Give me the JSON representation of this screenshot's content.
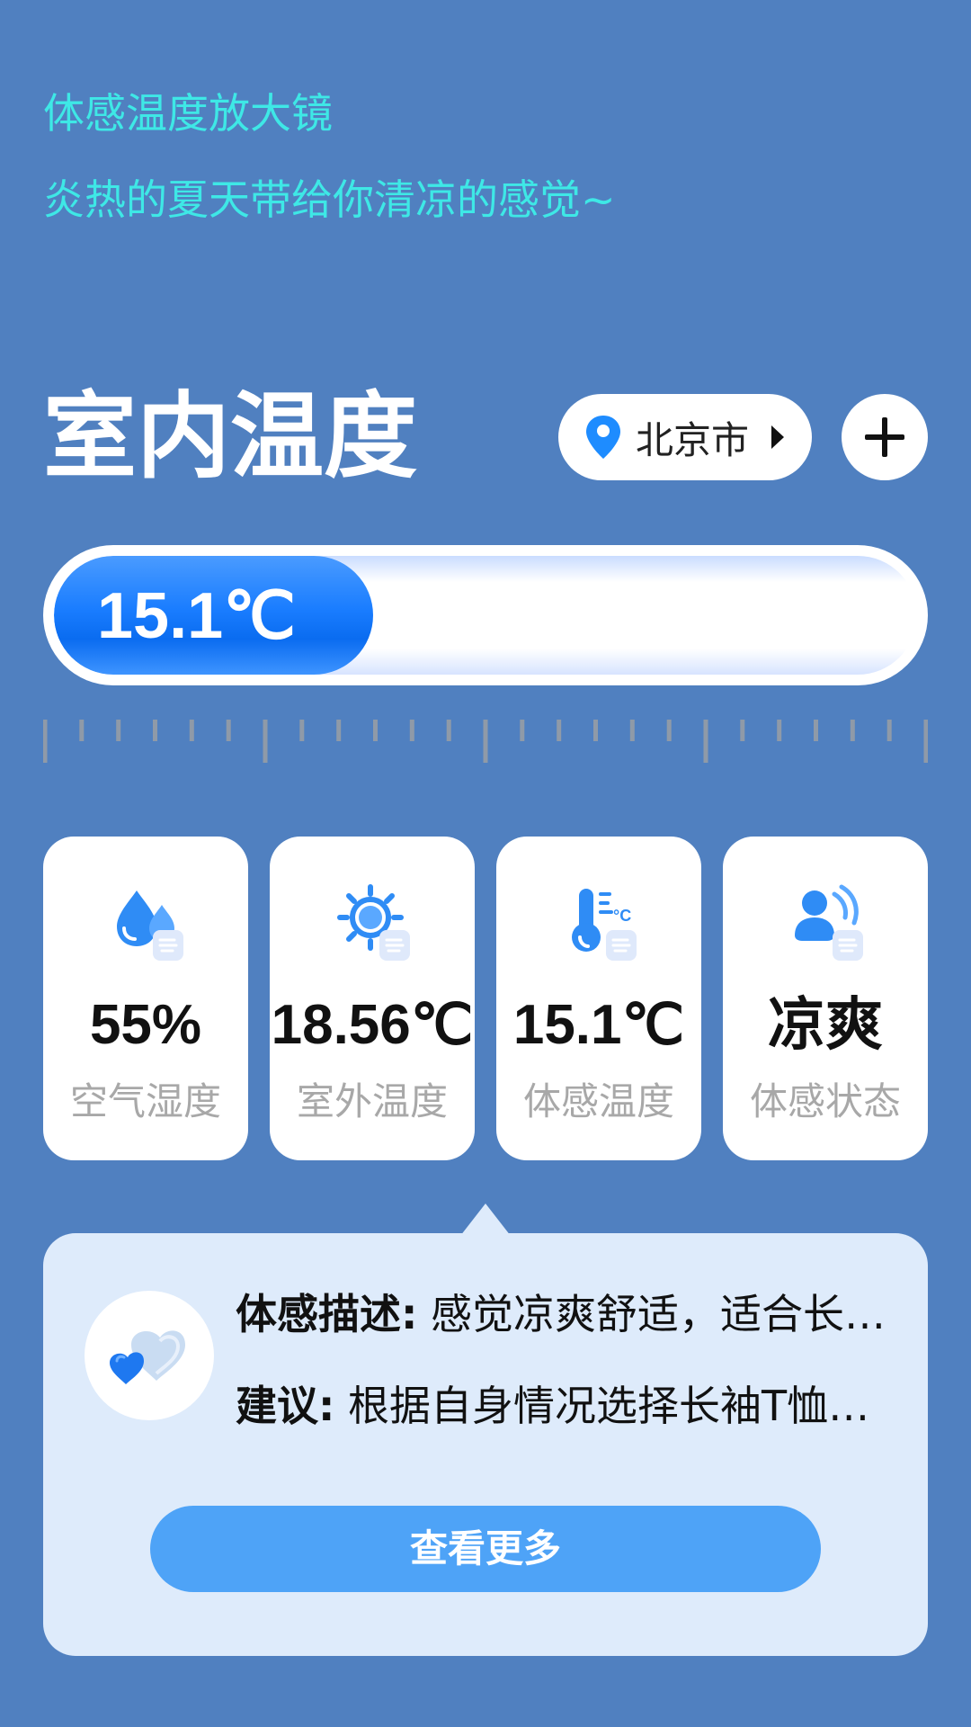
{
  "header": {
    "title": "体感温度放大镜",
    "subtitle": "炎热的夏天带给你清凉的感觉~"
  },
  "indoor": {
    "title": "室内温度",
    "city": "北京市",
    "temperature_label": "15.1℃",
    "level_fraction": 0.37
  },
  "stats": [
    {
      "value": "55%",
      "label": "空气湿度",
      "icon": "humidity-drop-icon"
    },
    {
      "value": "18.56℃",
      "label": "室外温度",
      "icon": "sun-icon"
    },
    {
      "value": "15.1℃",
      "label": "体感温度",
      "icon": "thermometer-icon"
    },
    {
      "value": "凉爽",
      "label": "体感状态",
      "icon": "person-comfort-icon"
    }
  ],
  "advice": {
    "desc_label": "体感描述:",
    "desc_text": "感觉凉爽舒适，适合长时间外出活动",
    "suggest_label": "建议:",
    "suggest_text": "根据自身情况选择长袖T恤或薄外套",
    "more_button": "查看更多"
  },
  "colors": {
    "background": "#5080c0",
    "accent_text": "#3ee8e6",
    "primary_blue": "#1a7dff",
    "button_blue": "#4ea3f7",
    "card_panel": "#deebfb"
  }
}
